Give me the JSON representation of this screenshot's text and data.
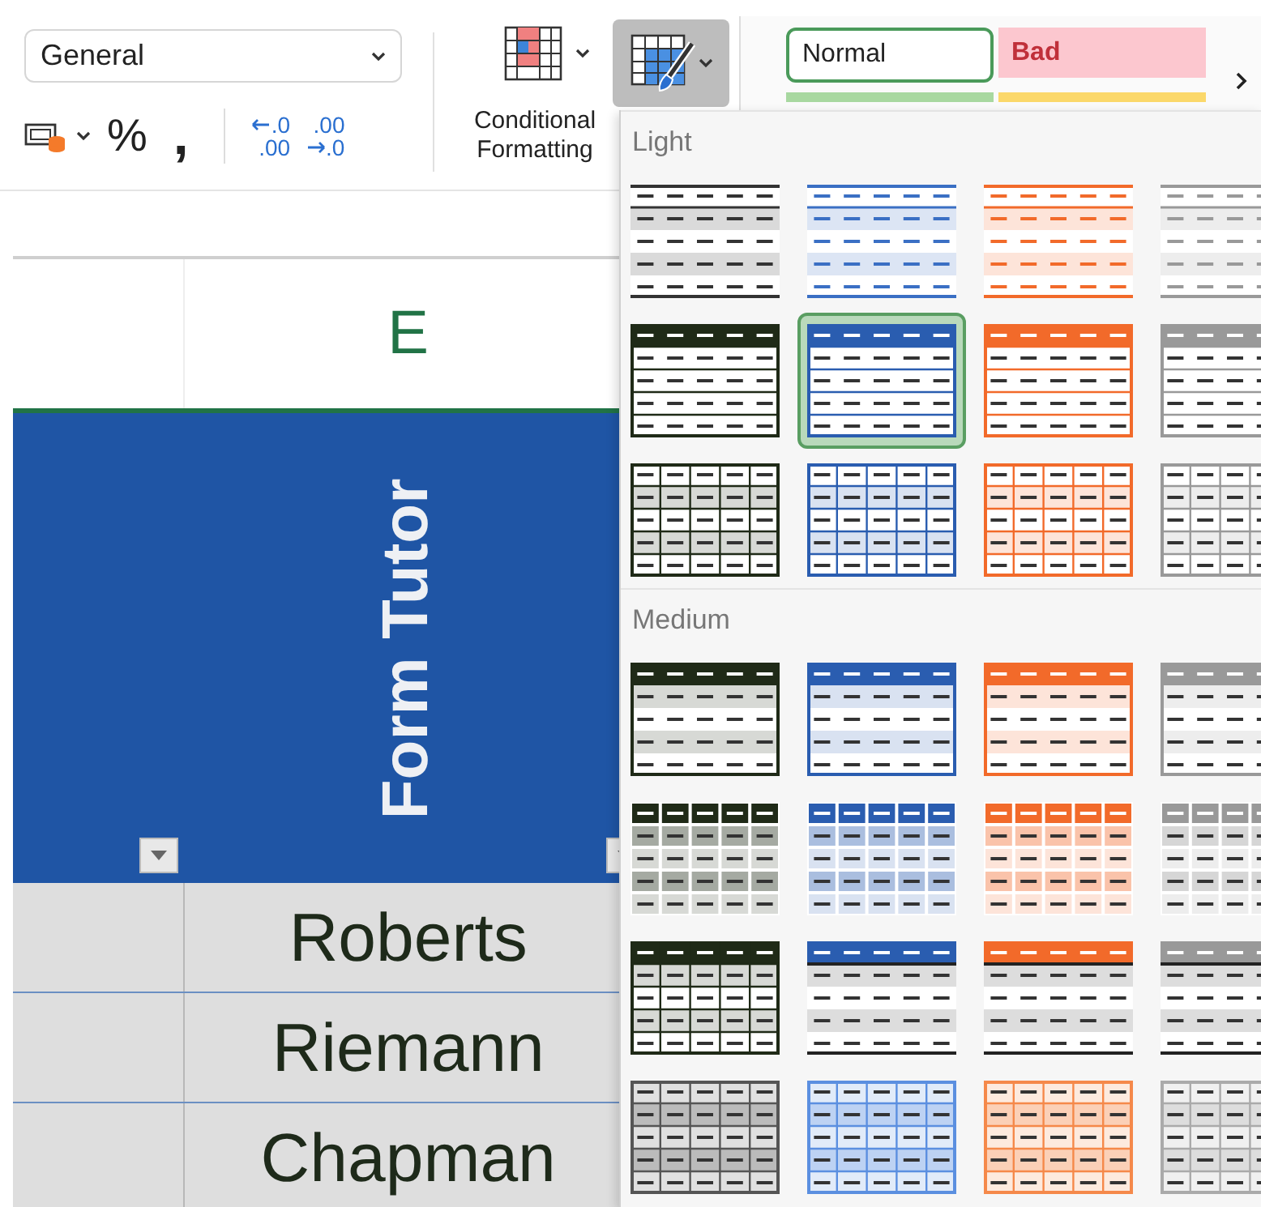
{
  "ribbon": {
    "number_format": {
      "value": "General"
    },
    "number_buttons": [
      {
        "kind": "accounting"
      },
      {
        "kind": "percent",
        "text": "%"
      },
      {
        "kind": "comma",
        "text": ","
      },
      {
        "kind": "increase-decimal",
        "top": ".0",
        "bottom": ".00"
      },
      {
        "kind": "decrease-decimal",
        "top": ".00",
        "bottom": ".0"
      }
    ],
    "conditional_formatting": {
      "label": "Conditional Formatting"
    },
    "format_as_table": {
      "pressed": true
    },
    "cell_styles": [
      {
        "kind": "normal",
        "label": "Normal"
      },
      {
        "kind": "bad",
        "label": "Bad"
      }
    ]
  },
  "sheet": {
    "column_header": "E",
    "table_header": "Form Tutor",
    "rows": [
      "Roberts",
      "Riemann",
      "Chapman"
    ]
  },
  "table_styles_panel": {
    "sections": [
      {
        "label": "Light",
        "styles": [
          {
            "kind": "lines",
            "color": "#333333",
            "selected": false
          },
          {
            "kind": "lines",
            "color": "#3a6fc4",
            "selected": false
          },
          {
            "kind": "lines",
            "color": "#f26a2a",
            "selected": false
          },
          {
            "kind": "lines",
            "color": "#999999",
            "selected": false
          },
          {
            "kind": "header",
            "color": "#1f2a17",
            "selected": false
          },
          {
            "kind": "header",
            "color": "#2a5db0",
            "selected": true
          },
          {
            "kind": "header",
            "color": "#f26a2a",
            "selected": false
          },
          {
            "kind": "header",
            "color": "#999999",
            "selected": false
          },
          {
            "kind": "grid",
            "color": "#1f2a17",
            "selected": false
          },
          {
            "kind": "grid",
            "color": "#2a5db0",
            "selected": false
          },
          {
            "kind": "grid",
            "color": "#f26a2a",
            "selected": false
          },
          {
            "kind": "grid",
            "color": "#999999",
            "selected": false
          }
        ]
      },
      {
        "label": "Medium",
        "styles": [
          {
            "kind": "banded",
            "color": "#1f2a17",
            "selected": false
          },
          {
            "kind": "banded",
            "color": "#2a5db0",
            "selected": false
          },
          {
            "kind": "banded",
            "color": "#f26a2a",
            "selected": false
          },
          {
            "kind": "banded",
            "color": "#999999",
            "selected": false
          },
          {
            "kind": "tiled",
            "color": "#1f2a17",
            "selected": false
          },
          {
            "kind": "tiled",
            "color": "#2a5db0",
            "selected": false
          },
          {
            "kind": "tiled",
            "color": "#f26a2a",
            "selected": false
          },
          {
            "kind": "tiled",
            "color": "#999999",
            "selected": false
          },
          {
            "kind": "header-grid",
            "color": "#1f2a17",
            "selected": false
          },
          {
            "kind": "header-lines",
            "color": "#2a5db0",
            "selected": false
          },
          {
            "kind": "header-lines",
            "color": "#f26a2a",
            "selected": false
          },
          {
            "kind": "header-lines",
            "color": "#999999",
            "selected": false
          },
          {
            "kind": "grid-shaded",
            "color": "#555555",
            "selected": false
          },
          {
            "kind": "grid-shaded",
            "color": "#5b8fe0",
            "selected": false
          },
          {
            "kind": "grid-shaded",
            "color": "#f5894a",
            "selected": false
          },
          {
            "kind": "grid-shaded",
            "color": "#aaaaaa",
            "selected": false
          }
        ]
      }
    ]
  }
}
